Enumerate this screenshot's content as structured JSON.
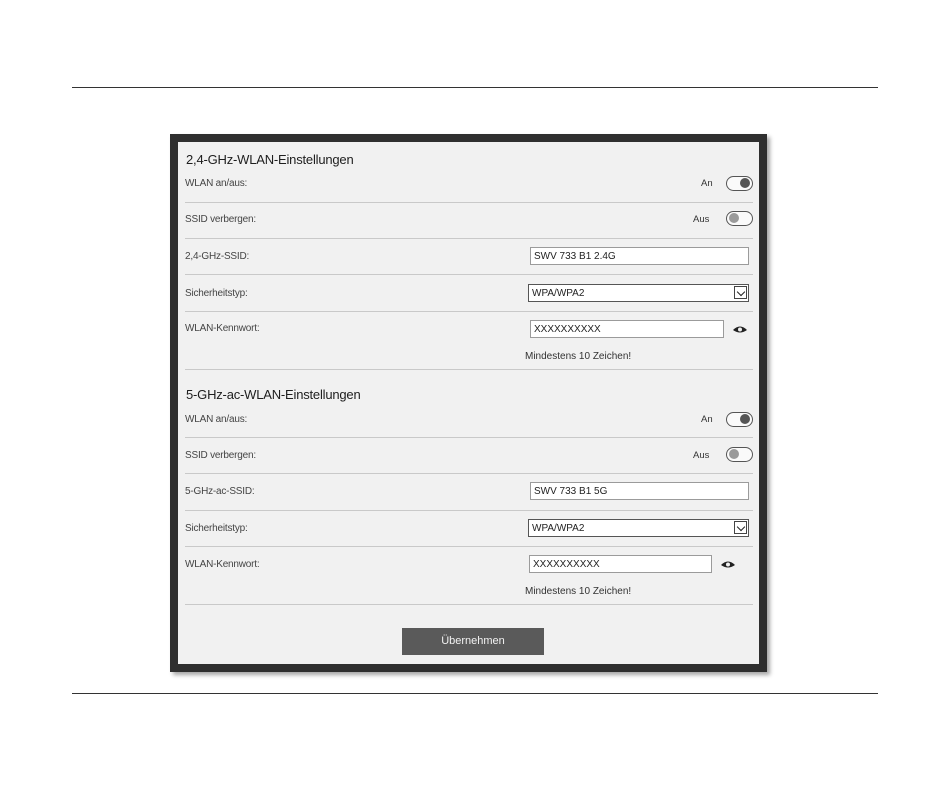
{
  "section_24": {
    "title": "2,4-GHz-WLAN-Einstellungen",
    "wlan_label": "WLAN an/aus:",
    "wlan_state": "An",
    "ssid_hide_label": "SSID verbergen:",
    "ssid_hide_state": "Aus",
    "ssid_label": "2,4-GHz-SSID:",
    "ssid_value": "SWV 733 B1 2.4G",
    "security_label": "Sicherheitstyp:",
    "security_value": "WPA/WPA2",
    "password_label": "WLAN-Kennwort:",
    "password_value": "XXXXXXXXXX",
    "password_hint": "Mindestens 10 Zeichen!"
  },
  "section_5": {
    "title": "5-GHz-ac-WLAN-Einstellungen",
    "wlan_label": "WLAN an/aus:",
    "wlan_state": "An",
    "ssid_hide_label": "SSID verbergen:",
    "ssid_hide_state": "Aus",
    "ssid_label": "5-GHz-ac-SSID:",
    "ssid_value": "SWV 733 B1 5G",
    "security_label": "Sicherheitstyp:",
    "security_value": "WPA/WPA2",
    "password_label": "WLAN-Kennwort:",
    "password_value": "XXXXXXXXXX",
    "password_hint": "Mindestens 10 Zeichen!"
  },
  "apply_button": "Übernehmen",
  "icons": {
    "toggle": "toggle-switch",
    "dropdown": "chevron-down-icon",
    "reveal_password": "eye-icon"
  }
}
